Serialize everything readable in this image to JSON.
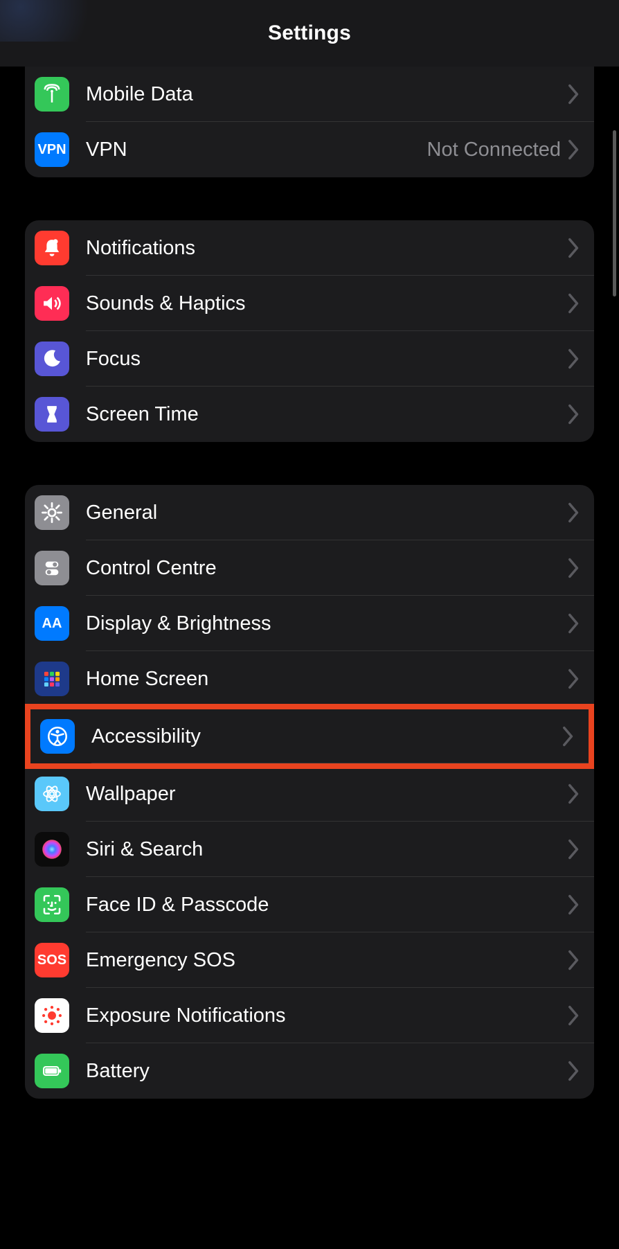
{
  "header": {
    "title": "Settings"
  },
  "icons": {
    "mobile-data": "antenna-icon",
    "vpn": "vpn-icon",
    "notifications": "bell-icon",
    "sounds": "speaker-icon",
    "focus": "moon-icon",
    "screentime": "hourglass-icon",
    "general": "gear-icon",
    "control-centre": "toggles-icon",
    "display": "aa-icon",
    "home-screen": "grid-icon",
    "accessibility": "accessibility-icon",
    "wallpaper": "flower-icon",
    "siri": "siri-icon",
    "faceid": "faceid-icon",
    "sos": "sos-icon",
    "exposure": "exposure-icon",
    "battery": "battery-icon"
  },
  "groups": [
    {
      "id": "connectivity",
      "items": [
        {
          "key": "mobile-data",
          "label": "Mobile Data",
          "value": "",
          "iconBg": "bg-green"
        },
        {
          "key": "vpn",
          "label": "VPN",
          "value": "Not Connected",
          "iconBg": "bg-blue",
          "iconText": "VPN"
        }
      ]
    },
    {
      "id": "notifications",
      "items": [
        {
          "key": "notifications",
          "label": "Notifications",
          "value": "",
          "iconBg": "bg-red"
        },
        {
          "key": "sounds",
          "label": "Sounds & Haptics",
          "value": "",
          "iconBg": "bg-pink"
        },
        {
          "key": "focus",
          "label": "Focus",
          "value": "",
          "iconBg": "bg-indigo"
        },
        {
          "key": "screentime",
          "label": "Screen Time",
          "value": "",
          "iconBg": "bg-indigo"
        }
      ]
    },
    {
      "id": "general",
      "items": [
        {
          "key": "general",
          "label": "General",
          "value": "",
          "iconBg": "bg-gray"
        },
        {
          "key": "control-centre",
          "label": "Control Centre",
          "value": "",
          "iconBg": "bg-gray"
        },
        {
          "key": "display",
          "label": "Display & Brightness",
          "value": "",
          "iconBg": "bg-blue",
          "iconText": "AA"
        },
        {
          "key": "home-screen",
          "label": "Home Screen",
          "value": "",
          "iconBg": "bg-deepblue"
        },
        {
          "key": "accessibility",
          "label": "Accessibility",
          "value": "",
          "iconBg": "bg-blue",
          "highlight": true
        },
        {
          "key": "wallpaper",
          "label": "Wallpaper",
          "value": "",
          "iconBg": "bg-cyan"
        },
        {
          "key": "siri",
          "label": "Siri & Search",
          "value": "",
          "iconBg": "bg-black"
        },
        {
          "key": "faceid",
          "label": "Face ID & Passcode",
          "value": "",
          "iconBg": "bg-green"
        },
        {
          "key": "sos",
          "label": "Emergency SOS",
          "value": "",
          "iconBg": "bg-red",
          "iconText": "SOS"
        },
        {
          "key": "exposure",
          "label": "Exposure Notifications",
          "value": "",
          "iconBg": "bg-white"
        },
        {
          "key": "battery",
          "label": "Battery",
          "value": "",
          "iconBg": "bg-green"
        }
      ]
    }
  ]
}
